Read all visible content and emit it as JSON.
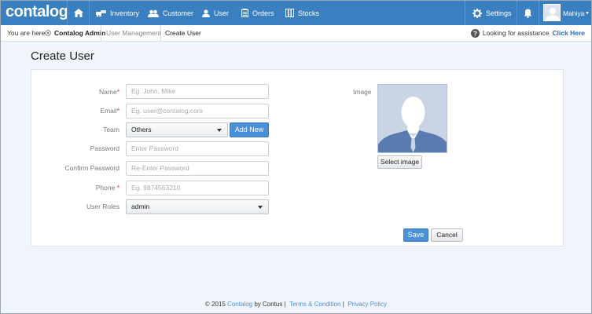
{
  "app": {
    "logo": "contalog"
  },
  "nav": {
    "home_icon": "home-icon",
    "items": [
      {
        "label": "Inventory",
        "icon": "cars-icon"
      },
      {
        "label": "Customer",
        "icon": "users-icon"
      },
      {
        "label": "User",
        "icon": "user-icon"
      },
      {
        "label": "Orders",
        "icon": "clipboard-icon"
      },
      {
        "label": "Stocks",
        "icon": "stack-icon"
      }
    ],
    "settings": "Settings",
    "user_name": "Mahiya"
  },
  "breadcrumb": {
    "you_are_here": "You are here",
    "items": [
      "Contalog Admin",
      "User Management",
      "Create User"
    ],
    "help_text": "Looking for assistance",
    "help_link": "Click Here"
  },
  "page": {
    "title": "Create User"
  },
  "form": {
    "name": {
      "label": "Name",
      "required": "*",
      "placeholder": "Eg. John, Mike"
    },
    "email": {
      "label": "Email",
      "required": "*",
      "placeholder": "Eg. user@contalog.com"
    },
    "team": {
      "label": "Team",
      "value": "Others",
      "add_label": "Add New"
    },
    "password": {
      "label": "Password",
      "placeholder": "Enter Password"
    },
    "confirm": {
      "label": "Confirm Password",
      "placeholder": "Re-Enter Password"
    },
    "phone": {
      "label": "Phone",
      "required": "*",
      "placeholder": "Eg. 9874563210"
    },
    "roles": {
      "label": "User Roles",
      "value": "admin"
    },
    "image": {
      "label": "Image",
      "select_label": "Select image"
    },
    "save_label": "Save",
    "cancel_label": "Cancel"
  },
  "footer": {
    "copyright": "© 2015",
    "brand": "Contalog",
    "by": "by Contus",
    "sep": "|",
    "terms": "Terms & Condition",
    "privacy": "Privacy Policy"
  },
  "colors": {
    "topbar": "#3a80c1",
    "primary_button": "#4a90d9",
    "background": "#f0f5fb"
  }
}
